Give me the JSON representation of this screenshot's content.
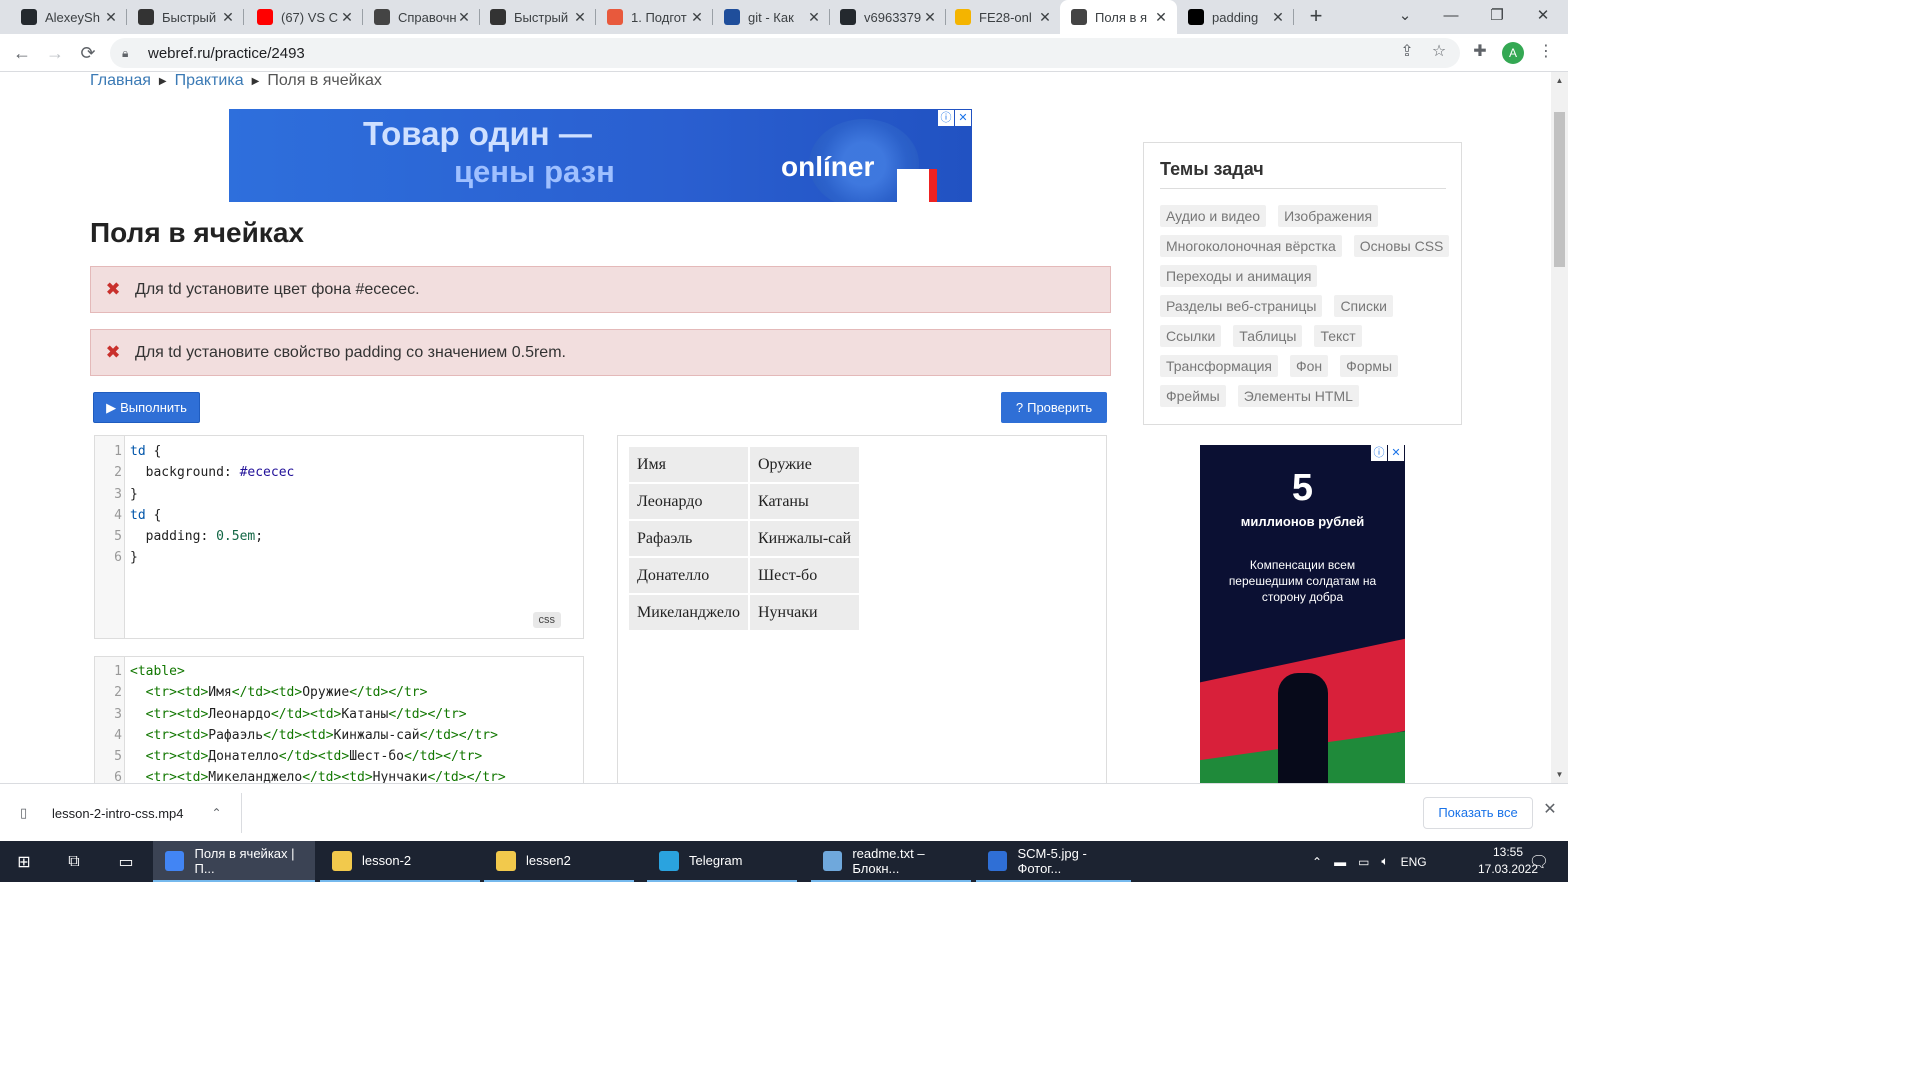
{
  "browser": {
    "tabs": [
      {
        "title": "AlexeySh",
        "icon": "github-icon",
        "color": "#24292e"
      },
      {
        "title": "Быстрый",
        "icon": "page-icon",
        "color": "#333333"
      },
      {
        "title": "(67) VS C",
        "icon": "youtube-icon",
        "color": "#ff0000"
      },
      {
        "title": "Справочн",
        "icon": "chat-icon",
        "color": "#444444"
      },
      {
        "title": "Быстрый",
        "icon": "page-icon",
        "color": "#333333"
      },
      {
        "title": "1. Подгот",
        "icon": "pdf-icon",
        "color": "#e8593c"
      },
      {
        "title": "git - Как",
        "icon": "stackoverflow-icon",
        "color": "#1f4e9b"
      },
      {
        "title": "v6963379",
        "icon": "github-icon",
        "color": "#24292e"
      },
      {
        "title": "FE28-onl",
        "icon": "drive-icon",
        "color": "#f4b400"
      },
      {
        "title": "Поля в я",
        "icon": "chat-icon",
        "color": "#444444"
      },
      {
        "title": "padding",
        "icon": "mdn-icon",
        "color": "#000000"
      }
    ],
    "active_tab_index": 9,
    "url": "webref.ru/practice/2493",
    "profile_initial": "A"
  },
  "page": {
    "breadcrumb": [
      {
        "label": "Главная"
      },
      {
        "label": "Практика"
      },
      {
        "label": "Поля в ячейках"
      }
    ],
    "ad_top": {
      "line1": "Товар один —",
      "line2": "цены разн",
      "brand": "onlíner"
    },
    "title": "Поля в ячейках",
    "alerts": [
      "Для td установите цвет фона #ececec.",
      "Для td установите свойство padding со значением 0.5rem."
    ],
    "run_button": "Выполнить",
    "check_button": "Проверить",
    "css_badge": "css",
    "css_code": [
      "td {",
      "  background: #ececec",
      "}",
      "td {",
      "  padding: 0.5em;",
      "}"
    ],
    "html_code": [
      "<table>",
      "  <tr><td>Имя</td><td>Оружие</td></tr>",
      "  <tr><td>Леонардо</td><td>Катаны</td></tr>",
      "  <tr><td>Рафаэль</td><td>Кинжалы-сай</td></tr>",
      "  <tr><td>Донателло</td><td>Шест-бо</td></tr>",
      "  <tr><td>Микеланджело</td><td>Нунчаки</td></tr>"
    ],
    "preview_table": [
      [
        "Имя",
        "Оружие"
      ],
      [
        "Леонардо",
        "Катаны"
      ],
      [
        "Рафаэль",
        "Кинжалы-сай"
      ],
      [
        "Донателло",
        "Шест-бо"
      ],
      [
        "Микеланджело",
        "Нунчаки"
      ]
    ],
    "sidebar": {
      "title": "Темы задач",
      "topics": [
        "Аудио и видео",
        "Изображения",
        "Многоколоночная вёрстка",
        "Основы CSS",
        "Переходы и анимация",
        "Разделы веб-страницы",
        "Списки",
        "Ссылки",
        "Таблицы",
        "Текст",
        "Трансформация",
        "Фон",
        "Формы",
        "Фреймы",
        "Элементы HTML"
      ]
    },
    "ad_side": {
      "big": "5",
      "sub": "миллионов рублей",
      "body": "Компенсации всем перешедшим солдатам на сторону добра"
    }
  },
  "downloads": {
    "file": "lesson-2-intro-css.mp4",
    "show_all": "Показать все"
  },
  "taskbar": {
    "apps": [
      {
        "label": "Поля в ячейках | П...",
        "color": "#4285f4",
        "active": true
      },
      {
        "label": "lesson-2",
        "color": "#f2c94c",
        "active": false
      },
      {
        "label": "lessen2",
        "color": "#f2c94c",
        "active": false
      },
      {
        "label": "Telegram",
        "color": "#2aa3df",
        "active": false
      },
      {
        "label": "readme.txt – Блокн...",
        "color": "#6fa8dc",
        "active": false
      },
      {
        "label": "SCM-5.jpg - Фотог...",
        "color": "#2f6fd6",
        "active": false
      }
    ],
    "lang": "ENG",
    "time": "13:55",
    "date": "17.03.2022"
  },
  "colors": {
    "link": "#3b7ab5",
    "button": "#2f6fd6",
    "alert_bg": "#f2dede",
    "cell_bg": "#ececec"
  }
}
